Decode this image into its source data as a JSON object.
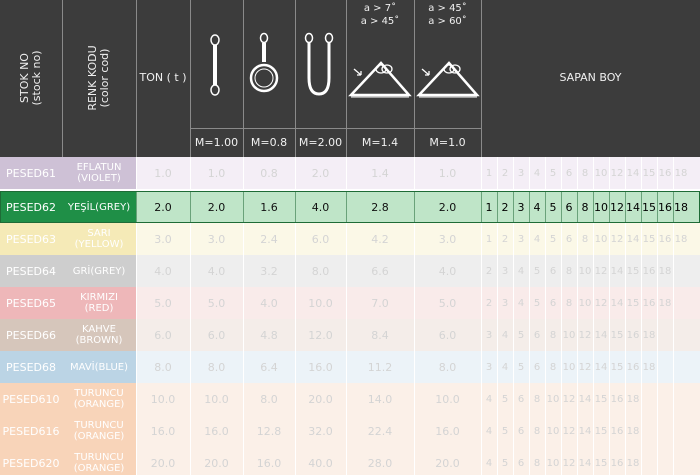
{
  "header": {
    "stock_no": "STOK NO",
    "stock_no_en": "(stock no)",
    "color_code": "RENK KODU",
    "color_code_en": "(color cod)",
    "ton": "TON ( t )",
    "sapan_boy": "SAPAN BOY",
    "angle_1a": "a > 7˚",
    "angle_1b": "a > 45˚",
    "angle_2a": "a > 45˚",
    "angle_2b": "a > 60˚",
    "m_factors": [
      "M=1.00",
      "M=0.8",
      "M=2.00",
      "M=1.4",
      "M=1.0"
    ]
  },
  "rows": [
    {
      "stock": "PESED61",
      "color1": "EFLATUN",
      "color2": "(VIOLET)",
      "bg": "#e6d9ea",
      "values": [
        "1.0",
        "1.0",
        "0.8",
        "2.0",
        "1.4",
        "1.0"
      ],
      "lengths": [
        "1",
        "2",
        "3",
        "4",
        "5",
        "6",
        "8",
        "10",
        "12",
        "14",
        "15",
        "16",
        "18"
      ],
      "stock_bg": "#8b6ea0"
    },
    {
      "stock": "PESED62",
      "color1": "YEŞİL(GREY)",
      "color2": "",
      "bg": "#bfe5c8",
      "values": [
        "2.0",
        "2.0",
        "1.6",
        "4.0",
        "2.8",
        "2.0"
      ],
      "lengths": [
        "1",
        "2",
        "3",
        "4",
        "5",
        "6",
        "8",
        "10",
        "12",
        "14",
        "15",
        "16",
        "18"
      ],
      "stock_bg": "#1f8f47"
    },
    {
      "stock": "PESED63",
      "color1": "SARI",
      "color2": "(YELLOW)",
      "bg": "#f6efc8",
      "values": [
        "3.0",
        "3.0",
        "2.4",
        "6.0",
        "4.2",
        "3.0"
      ],
      "lengths": [
        "1",
        "2",
        "3",
        "4",
        "5",
        "6",
        "8",
        "10",
        "12",
        "14",
        "15",
        "16",
        "18"
      ],
      "stock_bg": "#e8cf55"
    },
    {
      "stock": "PESED64",
      "color1": "GRİ(GREY)",
      "color2": "",
      "bg": "#d9d9d9",
      "values": [
        "4.0",
        "4.0",
        "3.2",
        "8.0",
        "6.6",
        "4.0"
      ],
      "lengths": [
        "2",
        "3",
        "4",
        "5",
        "6",
        "8",
        "10",
        "12",
        "14",
        "15",
        "16",
        "18"
      ],
      "stock_bg": "#8c8c8c"
    },
    {
      "stock": "PESED65",
      "color1": "KIRMIZI",
      "color2": "(RED)",
      "bg": "#f3d0cf",
      "values": [
        "5.0",
        "5.0",
        "4.0",
        "10.0",
        "7.0",
        "5.0"
      ],
      "lengths": [
        "2",
        "3",
        "4",
        "5",
        "6",
        "8",
        "10",
        "12",
        "14",
        "15",
        "16",
        "18"
      ],
      "stock_bg": "#d8555a"
    },
    {
      "stock": "PESED66",
      "color1": "KAHVE",
      "color2": "(BROWN)",
      "bg": "#e5d6cb",
      "values": [
        "6.0",
        "6.0",
        "4.8",
        "12.0",
        "8.4",
        "6.0"
      ],
      "lengths": [
        "3",
        "4",
        "5",
        "6",
        "8",
        "10",
        "12",
        "14",
        "15",
        "16",
        "18"
      ],
      "stock_bg": "#a07a5f"
    },
    {
      "stock": "PESED68",
      "color1": "MAVİ(BLUE)",
      "color2": "",
      "bg": "#d3e4ef",
      "values": [
        "8.0",
        "8.0",
        "6.4",
        "16.0",
        "11.2",
        "8.0"
      ],
      "lengths": [
        "3",
        "4",
        "5",
        "6",
        "8",
        "10",
        "12",
        "14",
        "15",
        "16",
        "18"
      ],
      "stock_bg": "#5e9ac2"
    },
    {
      "stock": "PESED610",
      "color1": "TURUNCU",
      "color2": "(ORANGE)",
      "bg": "#f6dcc9",
      "values": [
        "10.0",
        "10.0",
        "8.0",
        "20.0",
        "14.0",
        "10.0"
      ],
      "lengths": [
        "4",
        "5",
        "6",
        "8",
        "10",
        "12",
        "14",
        "15",
        "16",
        "18"
      ],
      "stock_bg": "#ef9a5a"
    },
    {
      "stock": "PESED616",
      "color1": "TURUNCU",
      "color2": "(ORANGE)",
      "bg": "#f6dcc9",
      "values": [
        "16.0",
        "16.0",
        "12.8",
        "32.0",
        "22.4",
        "16.0"
      ],
      "lengths": [
        "4",
        "5",
        "6",
        "8",
        "10",
        "12",
        "14",
        "15",
        "16",
        "18"
      ],
      "stock_bg": "#ef9a5a"
    },
    {
      "stock": "PESED620",
      "color1": "TURUNCU",
      "color2": "(ORANGE)",
      "bg": "#f6dcc9",
      "values": [
        "20.0",
        "20.0",
        "16.0",
        "40.0",
        "28.0",
        "20.0"
      ],
      "lengths": [
        "4",
        "5",
        "6",
        "8",
        "10",
        "12",
        "14",
        "15",
        "16",
        "18"
      ],
      "stock_bg": "#ef9a5a"
    }
  ]
}
